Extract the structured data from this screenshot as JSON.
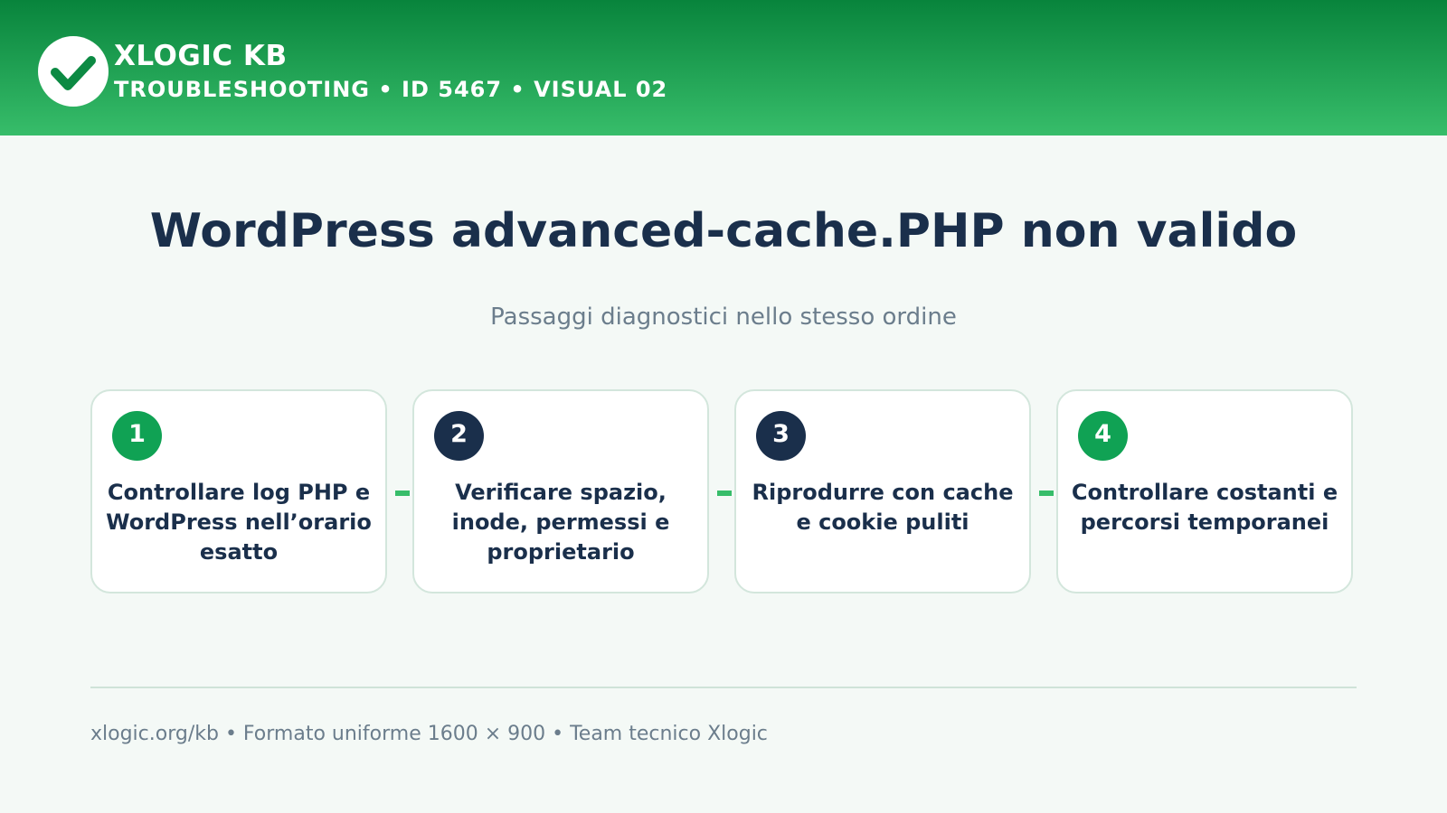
{
  "header": {
    "brand": "XLOGIC KB",
    "subtitle": "TROUBLESHOOTING • ID 5467 • VISUAL 02",
    "logo_icon": "checkmark-icon"
  },
  "main": {
    "title": "WordPress advanced-cache.PHP non valido",
    "subtitle": "Passaggi diagnostici nello stesso ordine",
    "steps": [
      {
        "number": "1",
        "text": "Controllare log PHP e WordPress nell’orario esatto",
        "badge_color": "#10a254"
      },
      {
        "number": "2",
        "text": "Verificare spazio, inode, permessi e proprietario",
        "badge_color": "#1a2f4b"
      },
      {
        "number": "3",
        "text": "Riprodurre con cache e cookie puliti",
        "badge_color": "#1a2f4b"
      },
      {
        "number": "4",
        "text": "Controllare costanti e percorsi temporanei",
        "badge_color": "#10a254"
      }
    ]
  },
  "footer": {
    "text": "xlogic.org/kb • Formato uniforme 1600 × 900 • Team tecnico Xlogic"
  },
  "colors": {
    "header_top": "#08843c",
    "header_bottom": "#37bd6a",
    "navy": "#1a2f4b",
    "green": "#10a254",
    "muted": "#6b7d8c",
    "background": "#f4f9f6"
  }
}
